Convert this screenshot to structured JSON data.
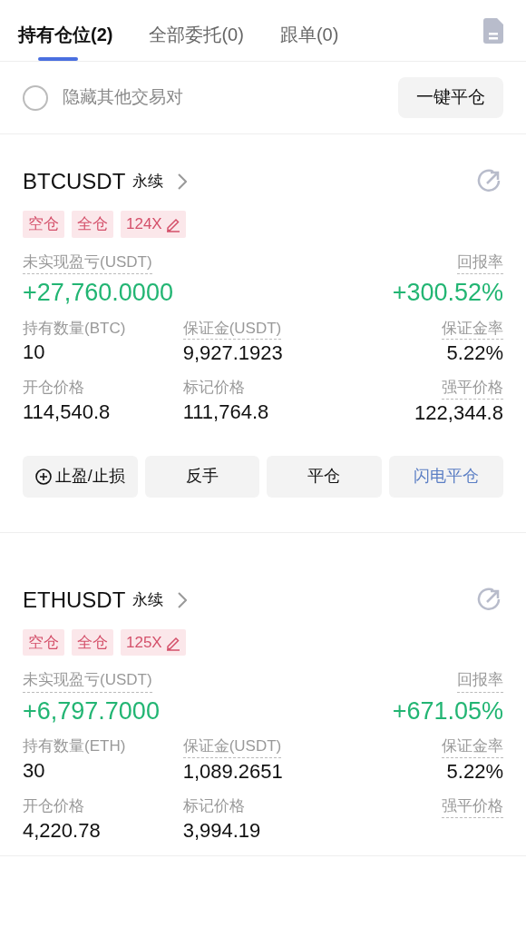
{
  "tabs": [
    {
      "label": "持有仓位(2)",
      "selected": true
    },
    {
      "label": "全部委托(0)",
      "selected": false
    },
    {
      "label": "跟单(0)",
      "selected": false
    }
  ],
  "filter": {
    "label": "隐藏其他交易对",
    "checked": false,
    "close_all_button": "一键平仓"
  },
  "positions": [
    {
      "symbol": "BTCUSDT",
      "contract": "永续",
      "tags": [
        {
          "kind": "text",
          "label": "空仓"
        },
        {
          "kind": "text",
          "label": "全仓"
        },
        {
          "kind": "leverage",
          "label": "124X"
        }
      ],
      "pnl_label": "未实现盈亏(USDT)",
      "pnl": "+27,760.0000",
      "roe_label": "回报率",
      "roe": "+300.52%",
      "fields": [
        {
          "label": "持有数量(BTC)",
          "value": "10",
          "dotted": false
        },
        {
          "label": "保证金(USDT)",
          "value": "9,927.1923",
          "dotted": true
        },
        {
          "label": "保证金率",
          "value": "5.22%",
          "dotted": true
        },
        {
          "label": "开仓价格",
          "value": "114,540.8",
          "dotted": false
        },
        {
          "label": "标记价格",
          "value": "111,764.8",
          "dotted": false
        },
        {
          "label": "强平价格",
          "value": "122,344.8",
          "dotted": true
        }
      ],
      "actions": [
        {
          "kind": "add",
          "label": "止盈/止损"
        },
        {
          "kind": "plain",
          "label": "反手"
        },
        {
          "kind": "plain",
          "label": "平仓"
        },
        {
          "kind": "accent",
          "label": "闪电平仓"
        }
      ]
    },
    {
      "symbol": "ETHUSDT",
      "contract": "永续",
      "tags": [
        {
          "kind": "text",
          "label": "空仓"
        },
        {
          "kind": "text",
          "label": "全仓"
        },
        {
          "kind": "leverage",
          "label": "125X"
        }
      ],
      "pnl_label": "未实现盈亏(USDT)",
      "pnl": "+6,797.7000",
      "roe_label": "回报率",
      "roe": "+671.05%",
      "fields": [
        {
          "label": "持有数量(ETH)",
          "value": "30",
          "dotted": false
        },
        {
          "label": "保证金(USDT)",
          "value": "1,089.2651",
          "dotted": true
        },
        {
          "label": "保证金率",
          "value": "5.22%",
          "dotted": true
        },
        {
          "label": "开仓价格",
          "value": "4,220.78",
          "dotted": false
        },
        {
          "label": "标记价格",
          "value": "3,994.19",
          "dotted": false
        },
        {
          "label": "强平价格",
          "dotted": true
        }
      ]
    }
  ]
}
